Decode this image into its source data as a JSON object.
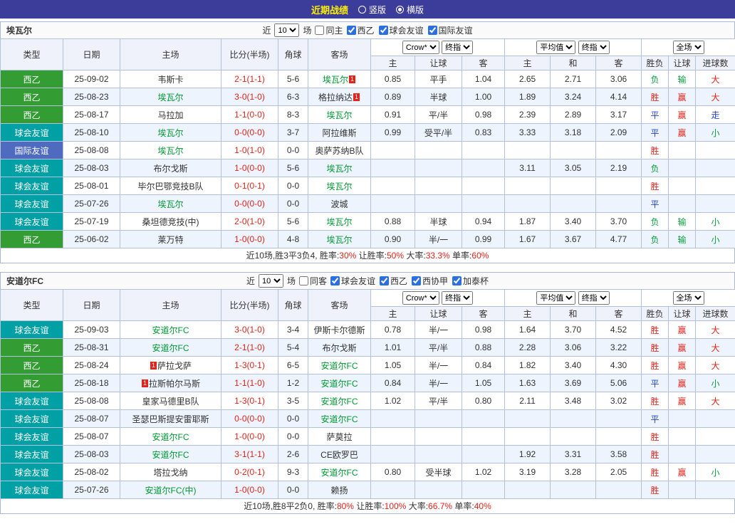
{
  "topbar": {
    "title": "近期战绩",
    "options": [
      {
        "label": "竖版",
        "selected": false
      },
      {
        "label": "横版",
        "selected": true
      }
    ]
  },
  "colors": {
    "topbar_bg": "#3c3c9b",
    "title_yellow": "#ffef00",
    "red": "#e2231a",
    "team_green": "#009933",
    "blue": "#2441d9"
  },
  "type_colors": {
    "西乙": "#339c33",
    "球会友谊": "#00a0a5",
    "国际友谊": "#4f6bbf"
  },
  "value_colors": {
    "胜": "#e2231a",
    "赢": "#e2231a",
    "大": "#e2231a",
    "平": "#2441d9",
    "走": "#2441d9",
    "负": "#0a9d3c",
    "输": "#0a9d3c",
    "小": "#0a9d3c"
  },
  "columns": {
    "type": "类型",
    "date": "日期",
    "home": "主场",
    "score": "比分(半场)",
    "corner": "角球",
    "away": "客场",
    "odds_book": "Crow*",
    "final_index": "终指",
    "avg": "平均值",
    "full": "全场",
    "odds_sub": [
      "主",
      "让球",
      "客"
    ],
    "avg_sub": [
      "主",
      "和",
      "客"
    ],
    "result_sub": [
      "胜负",
      "让球",
      "进球数"
    ]
  },
  "sections": [
    {
      "team": "埃瓦尔",
      "filter": {
        "near_label": "近",
        "count": "10",
        "games_label": "场",
        "same_label": "同主",
        "same_checked": false,
        "leagues": [
          "西乙",
          "球会友谊",
          "国际友谊"
        ]
      },
      "rows": [
        {
          "type": "西乙",
          "date": "25-09-02",
          "home": {
            "name": "韦斯卡"
          },
          "score": "2-1(1-1)",
          "corner": "5-6",
          "away": {
            "name": "埃瓦尔",
            "self": true,
            "post": "1"
          },
          "odds": [
            "0.85",
            "平手",
            "1.04"
          ],
          "avg": [
            "2.65",
            "2.71",
            "3.06"
          ],
          "res": [
            "负",
            "输",
            "大"
          ]
        },
        {
          "type": "西乙",
          "date": "25-08-23",
          "home": {
            "name": "埃瓦尔",
            "self": true
          },
          "score": "3-0(1-0)",
          "corner": "6-3",
          "away": {
            "name": "格拉纳达",
            "post": "1"
          },
          "odds": [
            "0.89",
            "半球",
            "1.00"
          ],
          "avg": [
            "1.89",
            "3.24",
            "4.14"
          ],
          "res": [
            "胜",
            "赢",
            "大"
          ]
        },
        {
          "type": "西乙",
          "date": "25-08-17",
          "home": {
            "name": "马拉加"
          },
          "score": "1-1(0-0)",
          "corner": "8-3",
          "away": {
            "name": "埃瓦尔",
            "self": true
          },
          "odds": [
            "0.91",
            "平/半",
            "0.98"
          ],
          "avg": [
            "2.39",
            "2.89",
            "3.17"
          ],
          "res": [
            "平",
            "赢",
            "走"
          ]
        },
        {
          "type": "球会友谊",
          "date": "25-08-10",
          "home": {
            "name": "埃瓦尔",
            "self": true
          },
          "score": "0-0(0-0)",
          "corner": "3-7",
          "away": {
            "name": "阿拉维斯"
          },
          "odds": [
            "0.99",
            "受平/半",
            "0.83"
          ],
          "avg": [
            "3.33",
            "3.18",
            "2.09"
          ],
          "res": [
            "平",
            "赢",
            "小"
          ]
        },
        {
          "type": "国际友谊",
          "date": "25-08-08",
          "home": {
            "name": "埃瓦尔",
            "self": true
          },
          "score": "1-0(1-0)",
          "corner": "0-0",
          "away": {
            "name": "奥萨苏纳B队"
          },
          "odds": [
            "",
            "",
            ""
          ],
          "avg": [
            "",
            "",
            ""
          ],
          "res": [
            "胜",
            "",
            ""
          ]
        },
        {
          "type": "球会友谊",
          "date": "25-08-03",
          "home": {
            "name": "布尔戈斯"
          },
          "score": "1-0(0-0)",
          "corner": "5-6",
          "away": {
            "name": "埃瓦尔",
            "self": true
          },
          "odds": [
            "",
            "",
            ""
          ],
          "avg": [
            "3.11",
            "3.05",
            "2.19"
          ],
          "res": [
            "负",
            "",
            ""
          ]
        },
        {
          "type": "球会友谊",
          "date": "25-08-01",
          "home": {
            "name": "毕尔巴鄂竞技B队"
          },
          "score": "0-1(0-1)",
          "corner": "0-0",
          "away": {
            "name": "埃瓦尔",
            "self": true
          },
          "odds": [
            "",
            "",
            ""
          ],
          "avg": [
            "",
            "",
            ""
          ],
          "res": [
            "胜",
            "",
            ""
          ]
        },
        {
          "type": "球会友谊",
          "date": "25-07-26",
          "home": {
            "name": "埃瓦尔",
            "self": true
          },
          "score": "0-0(0-0)",
          "corner": "0-0",
          "away": {
            "name": "波城"
          },
          "odds": [
            "",
            "",
            ""
          ],
          "avg": [
            "",
            "",
            ""
          ],
          "res": [
            "平",
            "",
            ""
          ]
        },
        {
          "type": "球会友谊",
          "date": "25-07-19",
          "home": {
            "name": "桑坦德竞技(中)"
          },
          "score": "2-0(1-0)",
          "corner": "5-6",
          "away": {
            "name": "埃瓦尔",
            "self": true
          },
          "odds": [
            "0.88",
            "半球",
            "0.94"
          ],
          "avg": [
            "1.87",
            "3.40",
            "3.70"
          ],
          "res": [
            "负",
            "输",
            "小"
          ]
        },
        {
          "type": "西乙",
          "date": "25-06-02",
          "home": {
            "name": "莱万特"
          },
          "score": "1-0(0-0)",
          "corner": "4-8",
          "away": {
            "name": "埃瓦尔",
            "self": true
          },
          "odds": [
            "0.90",
            "半/一",
            "0.99"
          ],
          "avg": [
            "1.67",
            "3.67",
            "4.77"
          ],
          "res": [
            "负",
            "输",
            "小"
          ]
        }
      ],
      "summary": {
        "parts": [
          {
            "t": "近10场,胜3平3负4, 胜率:",
            "c": "lbl"
          },
          {
            "t": "30%",
            "c": "val"
          },
          {
            "t": " 让胜率:",
            "c": "lbl"
          },
          {
            "t": "50%",
            "c": "val"
          },
          {
            "t": " 大率:",
            "c": "lbl"
          },
          {
            "t": "33.3%",
            "c": "val"
          },
          {
            "t": " 单率:",
            "c": "lbl"
          },
          {
            "t": "60%",
            "c": "val"
          }
        ]
      }
    },
    {
      "team": "安道尔FC",
      "filter": {
        "near_label": "近",
        "count": "10",
        "games_label": "场",
        "same_label": "同客",
        "same_checked": false,
        "leagues": [
          "球会友谊",
          "西乙",
          "西协甲",
          "加泰杯"
        ]
      },
      "rows": [
        {
          "type": "球会友谊",
          "date": "25-09-03",
          "home": {
            "name": "安道尔FC",
            "self": true
          },
          "score": "3-0(1-0)",
          "corner": "3-4",
          "away": {
            "name": "伊斯卡尔德斯"
          },
          "odds": [
            "0.78",
            "半/一",
            "0.98"
          ],
          "avg": [
            "1.64",
            "3.70",
            "4.52"
          ],
          "res": [
            "胜",
            "赢",
            "大"
          ]
        },
        {
          "type": "西乙",
          "date": "25-08-31",
          "home": {
            "name": "安道尔FC",
            "self": true
          },
          "score": "2-1(1-0)",
          "corner": "5-4",
          "away": {
            "name": "布尔戈斯"
          },
          "odds": [
            "1.01",
            "平/半",
            "0.88"
          ],
          "avg": [
            "2.28",
            "3.06",
            "3.22"
          ],
          "res": [
            "胜",
            "赢",
            "大"
          ]
        },
        {
          "type": "西乙",
          "date": "25-08-24",
          "home": {
            "name": "萨拉戈萨",
            "pre": "1"
          },
          "score": "1-3(0-1)",
          "corner": "6-5",
          "away": {
            "name": "安道尔FC",
            "self": true
          },
          "odds": [
            "1.05",
            "半/一",
            "0.84"
          ],
          "avg": [
            "1.82",
            "3.40",
            "4.30"
          ],
          "res": [
            "胜",
            "赢",
            "大"
          ]
        },
        {
          "type": "西乙",
          "date": "25-08-18",
          "home": {
            "name": "拉斯帕尔马斯",
            "pre": "1"
          },
          "score": "1-1(1-0)",
          "corner": "1-2",
          "away": {
            "name": "安道尔FC",
            "self": true
          },
          "odds": [
            "0.84",
            "半/一",
            "1.05"
          ],
          "avg": [
            "1.63",
            "3.69",
            "5.06"
          ],
          "res": [
            "平",
            "赢",
            "小"
          ]
        },
        {
          "type": "球会友谊",
          "date": "25-08-08",
          "home": {
            "name": "皇家马德里B队"
          },
          "score": "1-3(0-1)",
          "corner": "3-5",
          "away": {
            "name": "安道尔FC",
            "self": true
          },
          "odds": [
            "1.02",
            "平/半",
            "0.80"
          ],
          "avg": [
            "2.11",
            "3.48",
            "3.02"
          ],
          "res": [
            "胜",
            "赢",
            "大"
          ]
        },
        {
          "type": "球会友谊",
          "date": "25-08-07",
          "home": {
            "name": "圣瑟巴斯提安雷耶斯"
          },
          "score": "0-0(0-0)",
          "corner": "0-0",
          "away": {
            "name": "安道尔FC",
            "self": true
          },
          "odds": [
            "",
            "",
            ""
          ],
          "avg": [
            "",
            "",
            ""
          ],
          "res": [
            "平",
            "",
            ""
          ]
        },
        {
          "type": "球会友谊",
          "date": "25-08-07",
          "home": {
            "name": "安道尔FC",
            "self": true
          },
          "score": "1-0(0-0)",
          "corner": "0-0",
          "away": {
            "name": "萨莫拉"
          },
          "odds": [
            "",
            "",
            ""
          ],
          "avg": [
            "",
            "",
            ""
          ],
          "res": [
            "胜",
            "",
            ""
          ]
        },
        {
          "type": "球会友谊",
          "date": "25-08-03",
          "home": {
            "name": "安道尔FC",
            "self": true
          },
          "score": "3-1(1-1)",
          "corner": "2-6",
          "away": {
            "name": "CE欧罗巴"
          },
          "odds": [
            "",
            "",
            ""
          ],
          "avg": [
            "1.92",
            "3.31",
            "3.58"
          ],
          "res": [
            "胜",
            "",
            ""
          ]
        },
        {
          "type": "球会友谊",
          "date": "25-08-02",
          "home": {
            "name": "塔拉戈纳"
          },
          "score": "0-2(0-1)",
          "corner": "9-3",
          "away": {
            "name": "安道尔FC",
            "self": true
          },
          "odds": [
            "0.80",
            "受半球",
            "1.02"
          ],
          "avg": [
            "3.19",
            "3.28",
            "2.05"
          ],
          "res": [
            "胜",
            "赢",
            "小"
          ]
        },
        {
          "type": "球会友谊",
          "date": "25-07-26",
          "home": {
            "name": "安道尔FC(中)",
            "self": true
          },
          "score": "1-0(0-0)",
          "corner": "0-0",
          "away": {
            "name": "赖扬"
          },
          "odds": [
            "",
            "",
            ""
          ],
          "avg": [
            "",
            "",
            ""
          ],
          "res": [
            "胜",
            "",
            ""
          ]
        }
      ],
      "summary": {
        "parts": [
          {
            "t": "近10场,胜8平2负0, 胜率:",
            "c": "lbl"
          },
          {
            "t": "80%",
            "c": "val"
          },
          {
            "t": " 让胜率:",
            "c": "lbl"
          },
          {
            "t": "100%",
            "c": "val"
          },
          {
            "t": " 大率:",
            "c": "lbl"
          },
          {
            "t": "66.7%",
            "c": "val"
          },
          {
            "t": " 单率:",
            "c": "lbl"
          },
          {
            "t": "40%",
            "c": "val"
          }
        ]
      }
    }
  ]
}
